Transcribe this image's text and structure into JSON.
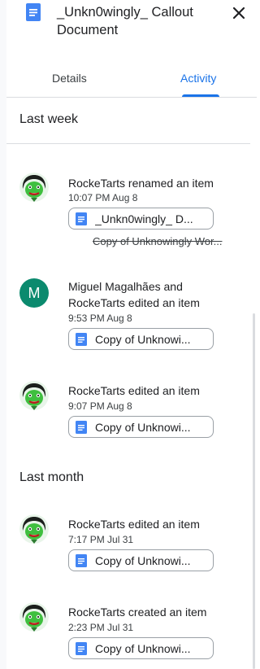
{
  "header": {
    "title": "_Unkn0wingly_ Callout Document",
    "close_icon": "close-icon",
    "doc_icon": "google-docs-icon"
  },
  "tabs": [
    {
      "label": "Details",
      "selected": false
    },
    {
      "label": "Activity",
      "selected": true
    }
  ],
  "colors": {
    "accent": "#1a73e8",
    "doc_blue": "#4285f4",
    "avatar_m": "#0b8a6e"
  },
  "sections": [
    {
      "heading": "Last week",
      "entries": [
        {
          "avatar": "rocketarts-avatar",
          "description": "RockeTarts renamed an item",
          "time": "10:07 PM Aug 8",
          "file": "_Unkn0wingly_ D...",
          "old_name": "Copy of Unknowingly Wor..."
        },
        {
          "avatar_letter": "M",
          "description": "Miguel Magalhães and RockeTarts edited an item",
          "time": "9:53 PM Aug 8",
          "file": "Copy of Unknowi..."
        },
        {
          "avatar": "rocketarts-avatar",
          "description": "RockeTarts edited an item",
          "time": "9:07 PM Aug 8",
          "file": "Copy of Unknowi..."
        }
      ]
    },
    {
      "heading": "Last month",
      "entries": [
        {
          "avatar": "rocketarts-avatar",
          "description": "RockeTarts edited an item",
          "time": "7:17 PM Jul 31",
          "file": "Copy of Unknowi..."
        },
        {
          "avatar": "rocketarts-avatar",
          "description": "RockeTarts created an item",
          "time": "2:23 PM Jul 31",
          "file": "Copy of Unknowi..."
        }
      ]
    }
  ]
}
